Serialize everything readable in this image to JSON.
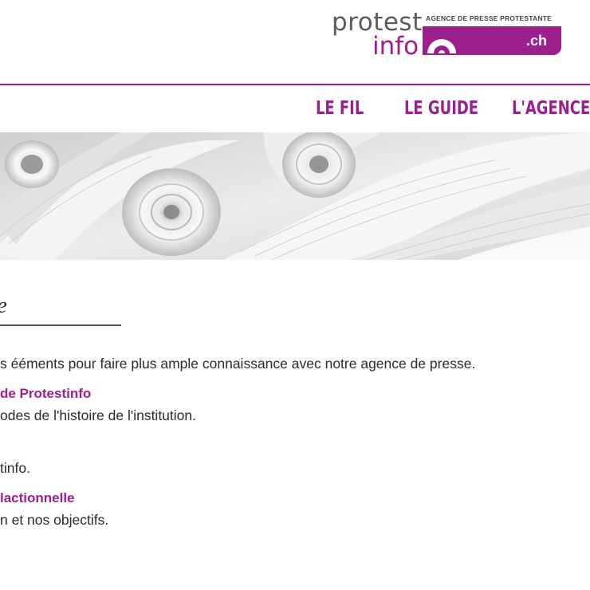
{
  "brand": {
    "word1": "protest",
    "word2": "info",
    "tagline": "AGENCE DE PRESSE PROTESTANTE",
    "tld": ".ch",
    "accent_color": "#9b1f8c"
  },
  "nav": {
    "items": [
      {
        "label": "LE FIL"
      },
      {
        "label": "LE GUIDE"
      },
      {
        "label": "L'AGENCE"
      }
    ]
  },
  "banner": {
    "subject": "rolled-paper-image"
  },
  "main": {
    "section_title": "e",
    "intro": "s ééments pour faire plus ample connaissance avec notre agence de presse.",
    "entries": [
      {
        "title": "de Protestinfo",
        "description": "odes de l'histoire de l'institution."
      },
      {
        "title": "",
        "description": "tinfo."
      },
      {
        "title": "lactionnelle",
        "description": "n et nos objectifs."
      }
    ]
  }
}
